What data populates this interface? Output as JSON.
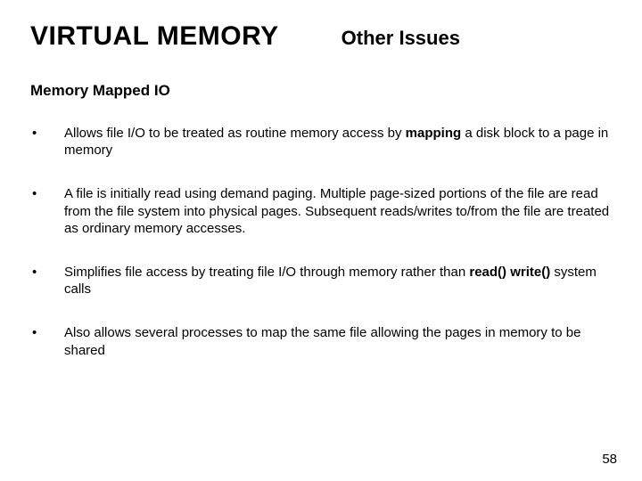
{
  "header": {
    "title": "VIRTUAL MEMORY",
    "subtitle": "Other Issues"
  },
  "section_heading": "Memory Mapped IO",
  "bullets": [
    {
      "pre": "Allows file I/O to be treated as routine memory access by ",
      "bold": "mapping",
      "post": " a disk block to a page in memory"
    },
    {
      "pre": "A file is initially read using demand paging. Multiple page-sized portions of the file are read from the file system into physical pages. Subsequent reads/writes to/from the file are treated as ordinary memory accesses.",
      "bold": "",
      "post": ""
    },
    {
      "pre": "Simplifies file access by treating file I/O through memory rather than ",
      "bold": "read() write()",
      "post": " system calls"
    },
    {
      "pre": "Also allows several processes to map the same file allowing the pages in memory to be shared",
      "bold": "",
      "post": ""
    }
  ],
  "page_number": "58",
  "bullet_marker": "•"
}
